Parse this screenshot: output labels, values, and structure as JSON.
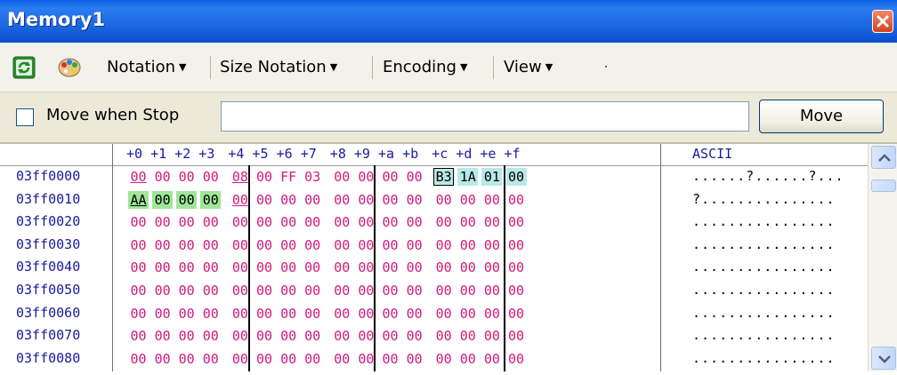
{
  "window": {
    "title": "Memory1"
  },
  "toolbar": {
    "menus": [
      {
        "label": "Notation",
        "arrow": "▼"
      },
      {
        "label": "Size Notation",
        "arrow": "▼"
      },
      {
        "label": "Encoding",
        "arrow": "▼"
      },
      {
        "label": "View",
        "arrow": "▼"
      }
    ],
    "icons": [
      "refresh-icon",
      "palette-icon"
    ]
  },
  "addressbar": {
    "checkbox_label": "Move when Stop",
    "checkbox_checked": false,
    "address_value": "",
    "move_button": "Move"
  },
  "grid": {
    "offset_headers": [
      "+0",
      "+1",
      "+2",
      "+3",
      "+4",
      "+5",
      "+6",
      "+7",
      "+8",
      "+9",
      "+a",
      "+b",
      "+c",
      "+d",
      "+e",
      "+f"
    ],
    "ascii_header": "ASCII",
    "rows": [
      {
        "address": "03ff0000",
        "bytes": [
          "00",
          "00",
          "00",
          "00",
          "08",
          "00",
          "FF",
          "03",
          "00",
          "00",
          "00",
          "00",
          "B3",
          "1A",
          "01",
          "00"
        ],
        "ascii": "......?......?..."
      },
      {
        "address": "03ff0010",
        "bytes": [
          "AA",
          "00",
          "00",
          "00",
          "00",
          "00",
          "00",
          "00",
          "00",
          "00",
          "00",
          "00",
          "00",
          "00",
          "00",
          "00"
        ],
        "ascii": "?..............."
      },
      {
        "address": "03ff0020",
        "bytes": [
          "00",
          "00",
          "00",
          "00",
          "00",
          "00",
          "00",
          "00",
          "00",
          "00",
          "00",
          "00",
          "00",
          "00",
          "00",
          "00"
        ],
        "ascii": "................"
      },
      {
        "address": "03ff0030",
        "bytes": [
          "00",
          "00",
          "00",
          "00",
          "00",
          "00",
          "00",
          "00",
          "00",
          "00",
          "00",
          "00",
          "00",
          "00",
          "00",
          "00"
        ],
        "ascii": "................"
      },
      {
        "address": "03ff0040",
        "bytes": [
          "00",
          "00",
          "00",
          "00",
          "00",
          "00",
          "00",
          "00",
          "00",
          "00",
          "00",
          "00",
          "00",
          "00",
          "00",
          "00"
        ],
        "ascii": "................"
      },
      {
        "address": "03ff0050",
        "bytes": [
          "00",
          "00",
          "00",
          "00",
          "00",
          "00",
          "00",
          "00",
          "00",
          "00",
          "00",
          "00",
          "00",
          "00",
          "00",
          "00"
        ],
        "ascii": "................"
      },
      {
        "address": "03ff0060",
        "bytes": [
          "00",
          "00",
          "00",
          "00",
          "00",
          "00",
          "00",
          "00",
          "00",
          "00",
          "00",
          "00",
          "00",
          "00",
          "00",
          "00"
        ],
        "ascii": "................"
      },
      {
        "address": "03ff0070",
        "bytes": [
          "00",
          "00",
          "00",
          "00",
          "00",
          "00",
          "00",
          "00",
          "00",
          "00",
          "00",
          "00",
          "00",
          "00",
          "00",
          "00"
        ],
        "ascii": "................"
      },
      {
        "address": "03ff0080",
        "bytes": [
          "00",
          "00",
          "00",
          "00",
          "00",
          "00",
          "00",
          "00",
          "00",
          "00",
          "00",
          "00",
          "00",
          "00",
          "00",
          "00"
        ],
        "ascii": "................"
      }
    ],
    "highlight": {
      "changed_cyan": [
        "0.12",
        "0.13",
        "0.14",
        "0.15"
      ],
      "changed_green": [
        "1.0",
        "1.1",
        "1.2",
        "1.3"
      ],
      "underlined": [
        "0.0",
        "0.4",
        "1.0",
        "1.4"
      ],
      "boxed": [
        "0.12"
      ]
    },
    "colors": {
      "value": "#d01a7a",
      "address": "#1a1a9a",
      "changed_cyan": "#b7e9e8",
      "changed_green": "#9fe59a"
    }
  },
  "scrollbar": {
    "up_icon": "chevron-up-icon",
    "down_icon": "chevron-down-icon"
  }
}
